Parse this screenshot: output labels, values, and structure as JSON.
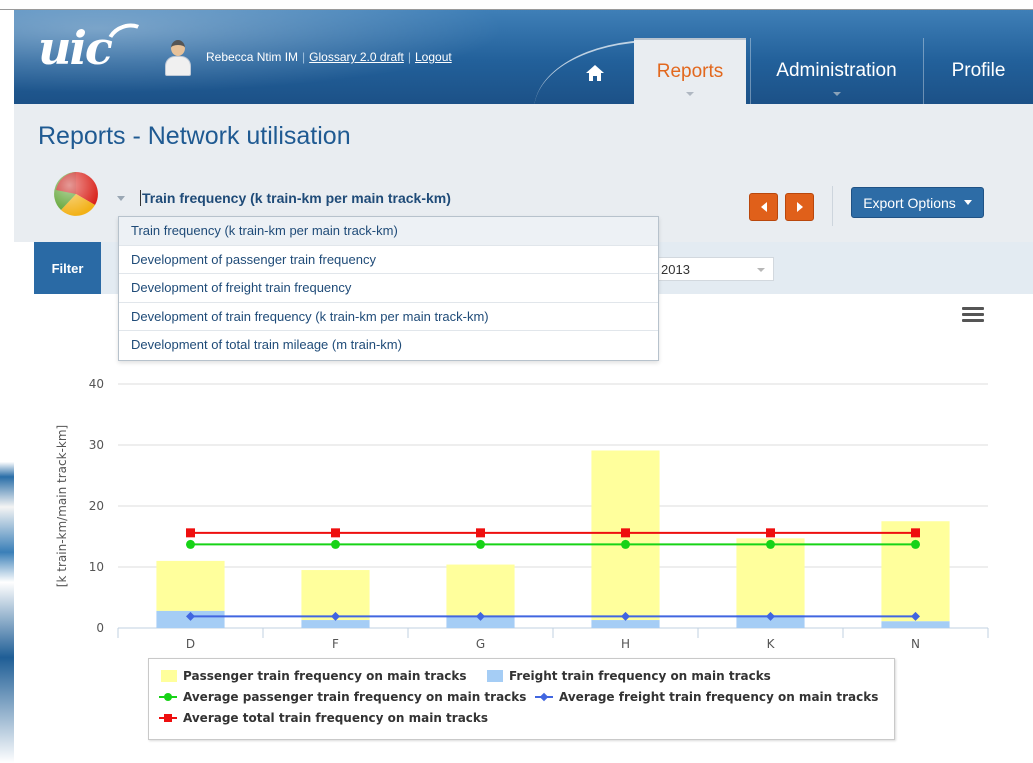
{
  "header": {
    "logo_text": "uic",
    "user_name": "Rebecca Ntim IM",
    "glossary_link": "Glossary 2.0 draft",
    "logout_link": "Logout",
    "tabs": [
      {
        "label": "Reports",
        "active": true
      },
      {
        "label": "Administration",
        "active": false
      },
      {
        "label": "Profile",
        "active": false
      }
    ]
  },
  "page": {
    "title": "Reports - Network utilisation",
    "selected_report": "Train frequency (k train-km per main track-km)",
    "export_label": "Export Options",
    "filter_label": "Filter",
    "year_value": "2013"
  },
  "report_options": [
    "Train frequency (k train-km per main track-km)",
    "Development of passenger train frequency",
    "Development of freight train frequency",
    "Development of train frequency (k train-km per main track-km)",
    "Development of total train mileage (m train-km)"
  ],
  "colors": {
    "passenger": "#ffff9c",
    "freight": "#a5cdf5",
    "avg_passenger": "#17d317",
    "avg_freight": "#4166e0",
    "avg_total": "#ee0f0f",
    "accent_orange": "#e0601a",
    "brand_blue": "#22609a"
  },
  "chart_data": {
    "type": "bar",
    "categories": [
      "D",
      "F",
      "G",
      "H",
      "K",
      "N"
    ],
    "ylabel": "[k train-km/main track-km]",
    "xlabel": "",
    "ylim": [
      0,
      40
    ],
    "yticks": [
      0,
      10,
      20,
      30,
      40
    ],
    "grid": true,
    "legend_position": "bottom",
    "series": [
      {
        "name": "Passenger train frequency on main tracks",
        "kind": "bar",
        "stack": "total",
        "values": [
          8.2,
          8.2,
          8.4,
          27.8,
          12.6,
          16.4
        ]
      },
      {
        "name": "Freight train frequency on main tracks",
        "kind": "bar",
        "stack": "total",
        "values": [
          2.8,
          1.3,
          2.0,
          1.3,
          2.1,
          1.1
        ]
      },
      {
        "name": "Average passenger train frequency on main tracks",
        "kind": "line",
        "marker": "circle",
        "values": [
          13.7,
          13.7,
          13.7,
          13.7,
          13.7,
          13.7
        ]
      },
      {
        "name": "Average freight train frequency on main tracks",
        "kind": "line",
        "marker": "diamond",
        "values": [
          1.9,
          1.9,
          1.9,
          1.9,
          1.9,
          1.9
        ]
      },
      {
        "name": "Average total train frequency on main tracks",
        "kind": "line",
        "marker": "square",
        "values": [
          15.6,
          15.6,
          15.6,
          15.6,
          15.6,
          15.6
        ]
      }
    ]
  }
}
